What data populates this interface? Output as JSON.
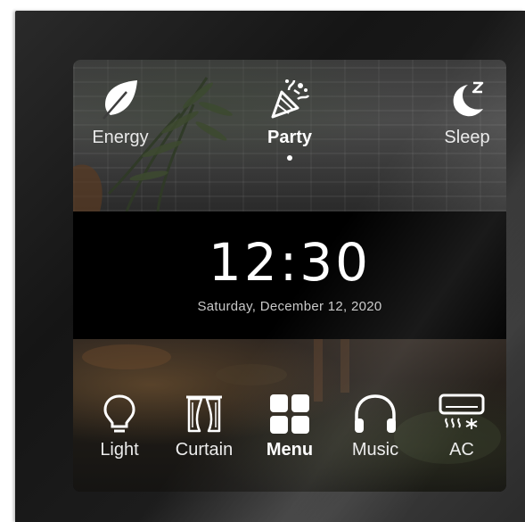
{
  "modes": [
    {
      "label": "Energy",
      "icon": "leaf-icon"
    },
    {
      "label": "Party",
      "icon": "party-popper-icon",
      "active": true
    },
    {
      "label": "Sleep",
      "icon": "moon-sleep-icon"
    }
  ],
  "clock": {
    "time": "12:30",
    "date": "Saturday, December 12, 2020"
  },
  "dock": [
    {
      "label": "Light",
      "icon": "lightbulb-icon"
    },
    {
      "label": "Curtain",
      "icon": "curtain-icon"
    },
    {
      "label": "Menu",
      "icon": "grid-icon",
      "active": true
    },
    {
      "label": "Music",
      "icon": "headphones-icon"
    },
    {
      "label": "AC",
      "icon": "air-conditioner-icon"
    }
  ],
  "colors": {
    "text": "#ffffff",
    "panel": "#000000",
    "device_frame": "#1e1e1e"
  }
}
